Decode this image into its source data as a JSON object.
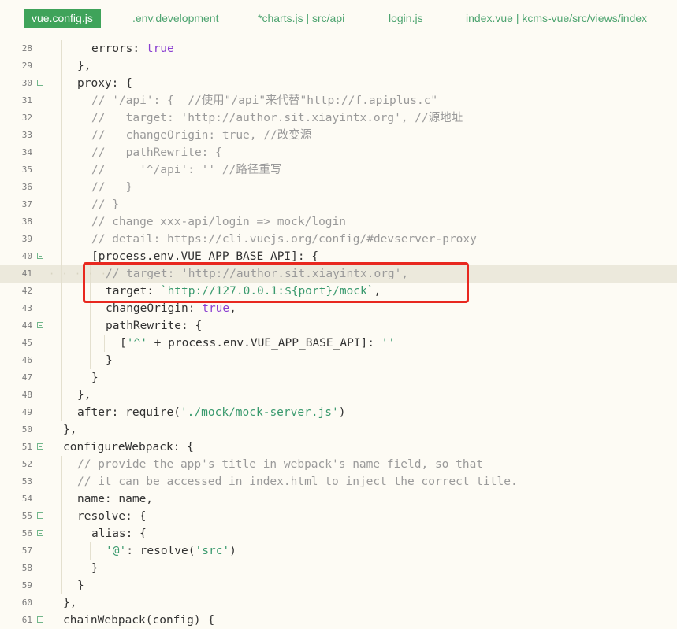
{
  "tabs": [
    {
      "label": "vue.config.js",
      "active": true
    },
    {
      "label": ".env.development",
      "active": false
    },
    {
      "label": "*charts.js | src/api",
      "active": false
    },
    {
      "label": "login.js",
      "active": false
    },
    {
      "label": "index.vue | kcms-vue/src/views/index",
      "active": false
    }
  ],
  "lines": [
    {
      "n": "28",
      "fold": false,
      "indent": 2,
      "html": "errors: <span class='bool'>true</span>"
    },
    {
      "n": "29",
      "fold": false,
      "indent": 1,
      "html": "},"
    },
    {
      "n": "30",
      "fold": true,
      "indent": 1,
      "html": "proxy: {"
    },
    {
      "n": "31",
      "fold": false,
      "indent": 2,
      "html": "<span class='cmt'>// '/api': {  //使用\"/api\"来代替\"http://f.apiplus.c\"</span>"
    },
    {
      "n": "32",
      "fold": false,
      "indent": 2,
      "html": "<span class='cmt'>//   target: 'http://author.sit.xiayintx.org', //源地址</span>"
    },
    {
      "n": "33",
      "fold": false,
      "indent": 2,
      "html": "<span class='cmt'>//   changeOrigin: true, //改变源</span>"
    },
    {
      "n": "34",
      "fold": false,
      "indent": 2,
      "html": "<span class='cmt'>//   pathRewrite: {</span>"
    },
    {
      "n": "35",
      "fold": false,
      "indent": 2,
      "html": "<span class='cmt'>//     '^/api': '' //路径重写</span>"
    },
    {
      "n": "36",
      "fold": false,
      "indent": 2,
      "html": "<span class='cmt'>//   }</span>"
    },
    {
      "n": "37",
      "fold": false,
      "indent": 2,
      "html": "<span class='cmt'>// }</span>"
    },
    {
      "n": "38",
      "fold": false,
      "indent": 2,
      "html": "<span class='cmt'>// change xxx-api/login => mock/login</span>"
    },
    {
      "n": "39",
      "fold": false,
      "indent": 2,
      "html": "<span class='cmt'>// detail: https://cli.vuejs.org/config/#devserver-proxy</span>"
    },
    {
      "n": "40",
      "fold": true,
      "indent": 2,
      "html": "[process.env.VUE_APP_BASE_API]: {"
    },
    {
      "n": "41",
      "fold": false,
      "indent": 3,
      "current": true,
      "html": "<span class='cmt'>// target: 'http://author.sit.xiayintx.org',</span>"
    },
    {
      "n": "42",
      "fold": false,
      "indent": 3,
      "html": "target: <span class='tpl'>`http://127.0.0.1:${port}/mock`</span>,"
    },
    {
      "n": "43",
      "fold": false,
      "indent": 3,
      "html": "changeOrigin: <span class='bool'>true</span>,"
    },
    {
      "n": "44",
      "fold": true,
      "indent": 3,
      "html": "pathRewrite: {"
    },
    {
      "n": "45",
      "fold": false,
      "indent": 4,
      "html": "[<span class='str'>'^'</span> + process.env.VUE_APP_BASE_API]: <span class='str'>''</span>"
    },
    {
      "n": "46",
      "fold": false,
      "indent": 3,
      "html": "}"
    },
    {
      "n": "47",
      "fold": false,
      "indent": 2,
      "html": "}"
    },
    {
      "n": "48",
      "fold": false,
      "indent": 1,
      "html": "},"
    },
    {
      "n": "49",
      "fold": false,
      "indent": 1,
      "html": "after: require(<span class='str'>'./mock/mock-server.js'</span>)"
    },
    {
      "n": "50",
      "fold": false,
      "indent": 0,
      "html": "},"
    },
    {
      "n": "51",
      "fold": true,
      "indent": 0,
      "html": "configureWebpack: {"
    },
    {
      "n": "52",
      "fold": false,
      "indent": 1,
      "html": "<span class='cmt'>// provide the app's title in webpack's name field, so that</span>"
    },
    {
      "n": "53",
      "fold": false,
      "indent": 1,
      "html": "<span class='cmt'>// it can be accessed in index.html to inject the correct title.</span>"
    },
    {
      "n": "54",
      "fold": false,
      "indent": 1,
      "html": "name: name,"
    },
    {
      "n": "55",
      "fold": true,
      "indent": 1,
      "html": "resolve: {"
    },
    {
      "n": "56",
      "fold": true,
      "indent": 2,
      "html": "alias: {"
    },
    {
      "n": "57",
      "fold": false,
      "indent": 3,
      "html": "<span class='str'>'@'</span>: resolve(<span class='str'>'src'</span>)"
    },
    {
      "n": "58",
      "fold": false,
      "indent": 2,
      "html": "}"
    },
    {
      "n": "59",
      "fold": false,
      "indent": 1,
      "html": "}"
    },
    {
      "n": "60",
      "fold": false,
      "indent": 0,
      "html": "},"
    },
    {
      "n": "61",
      "fold": true,
      "indent": 0,
      "html": "chainWebpack(config) {"
    }
  ],
  "colors": {
    "accent": "#3fa35a",
    "highlight_box": "#e8281f"
  }
}
